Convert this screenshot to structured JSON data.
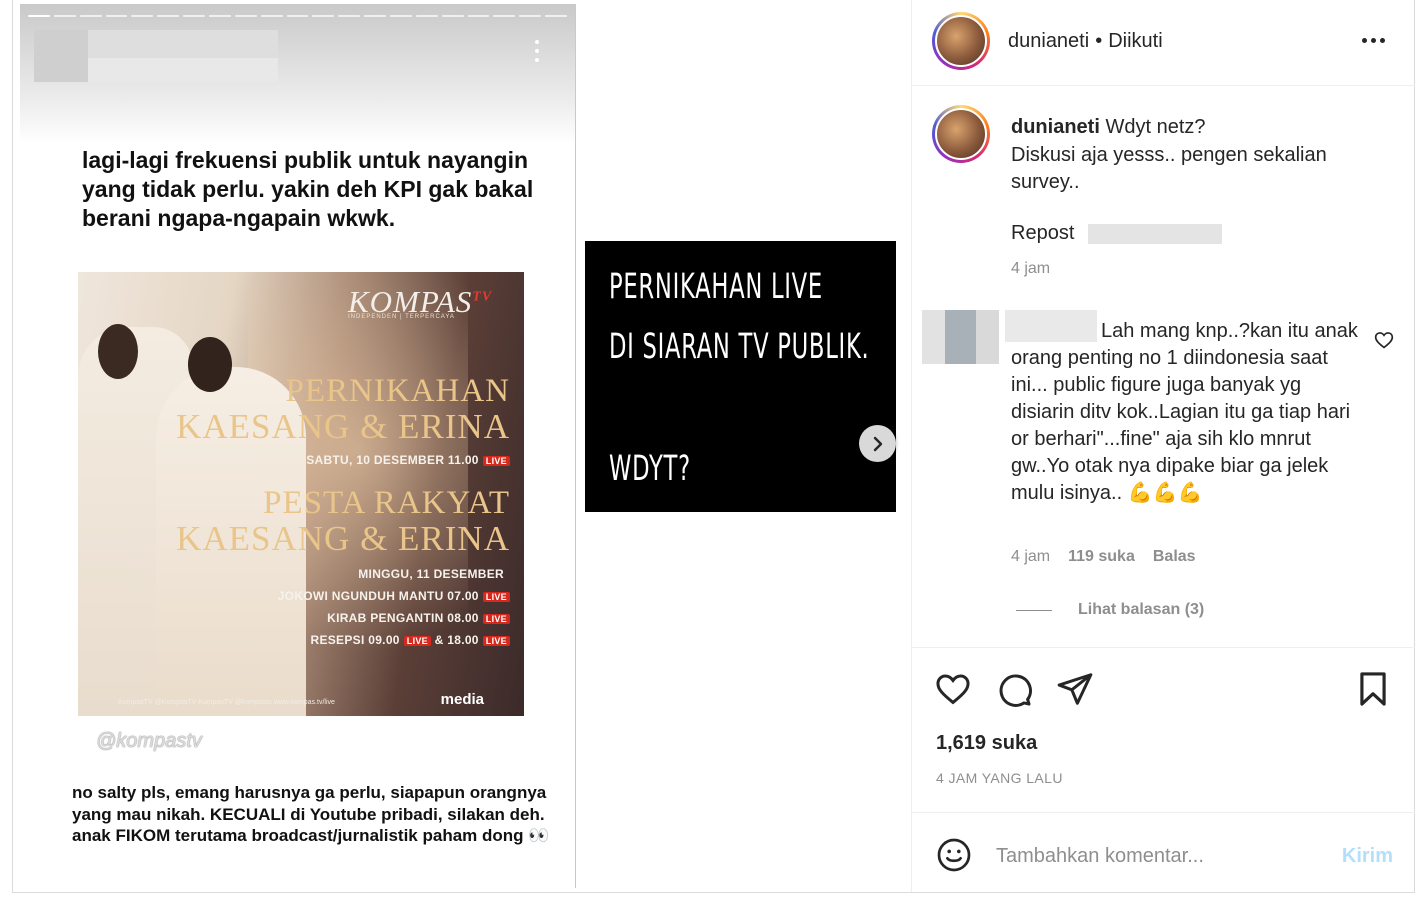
{
  "story": {
    "text_top": "lagi-lagi frekuensi publik untuk nayangin yang tidak perlu. yakin deh KPI gak bakal berani ngapa-ngapain wkwk.",
    "text_bottom": "no salty pls, emang harusnya ga perlu, siapapun orangnya yang mau nikah. KECUALI di Youtube pribadi, silakan deh. anak FIKOM terutama broadcast/jurnalistik paham dong 👀",
    "watermark": "@kompastv",
    "poster": {
      "logo": "KOMPAS",
      "logo_tv": "TV",
      "logo_sub": "INDEPENDEN | TERPERCAYA",
      "title1_line1": "PERNIKAHAN",
      "title1_line2": "KAESANG & ERINA",
      "date1": "SABTU, 10 DESEMBER 11.00",
      "title2_line1": "PESTA RAKYAT",
      "title2_line2": "KAESANG & ERINA",
      "date2": "MINGGU, 11 DESEMBER",
      "sched1": "JOKOWI NGUNDUH MANTU 07.00",
      "sched2": "KIRAB PENGANTIN 08.00",
      "sched3": "RESEPSI 09.00",
      "sched3b": "& 18.00",
      "live": "LIVE",
      "footer": "KompasTV  @KompasTV  KompasTV  @kompastv  www.kompas.tv/live",
      "media": "media"
    }
  },
  "card": {
    "line1": "PERNIKAHAN LIVE",
    "line2": "DI SIARAN TV PUBLIK.",
    "line3": "WDYT?"
  },
  "header": {
    "username": "dunianeti",
    "separator": "•",
    "follow_status": "Diikuti"
  },
  "caption": {
    "username": "dunianeti",
    "line1": "Wdyt netz?",
    "line2": "Diskusi aja yesss.. pengen sekalian survey..",
    "repost": "Repost",
    "time": "4 jam"
  },
  "comment": {
    "text": "Lah mang knp..?kan itu anak orang penting no 1 diindonesia saat ini... public figure juga banyak yg disiarin ditv kok..Lagian itu ga tiap hari or berhari\"...fine\" aja sih klo mnrut gw..Yo otak nya dipake biar ga jelek mulu isinya.. 💪💪💪",
    "time": "4 jam",
    "likes": "119 suka",
    "reply": "Balas",
    "view_replies": "Lihat balasan (3)"
  },
  "post": {
    "likes": "1,619 suka",
    "time_ago": "4 JAM YANG LALU"
  },
  "compose": {
    "placeholder": "Tambahkan komentar...",
    "send": "Kirim"
  },
  "colors": {
    "text": "#262626",
    "secondary": "#8e8e8e",
    "send_disabled": "#b2dffc",
    "live_red": "#d6281c",
    "poster_gold": "#e9c58a"
  }
}
